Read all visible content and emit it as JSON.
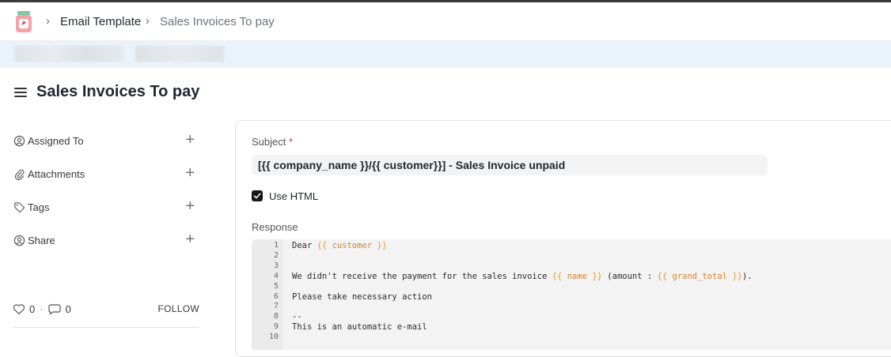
{
  "breadcrumb": {
    "items": [
      "Email Template",
      "Sales Invoices To pay"
    ]
  },
  "page": {
    "title": "Sales Invoices To pay"
  },
  "sidebar": {
    "items": [
      {
        "label": "Assigned To",
        "icon": "assign-user-icon"
      },
      {
        "label": "Attachments",
        "icon": "paperclip-icon"
      },
      {
        "label": "Tags",
        "icon": "tag-icon"
      },
      {
        "label": "Share",
        "icon": "share-user-icon"
      }
    ],
    "likes": "0",
    "comments": "0",
    "follow_label": "FOLLOW"
  },
  "form": {
    "subject_label": "Subject",
    "subject_required_mark": "*",
    "subject_value": "[{{ company_name }}/{{ customer}}] - Sales Invoice unpaid",
    "use_html_label": "Use HTML",
    "use_html_checked": true,
    "response_label": "Response",
    "response_lines": [
      {
        "n": "1",
        "text": "Dear {{ customer }}"
      },
      {
        "n": "2",
        "text": ""
      },
      {
        "n": "3",
        "text": ""
      },
      {
        "n": "4",
        "text": "We didn't receive the payment for the sales invoice {{ name }} (amount : {{ grand_total }})."
      },
      {
        "n": "5",
        "text": ""
      },
      {
        "n": "6",
        "text": "Please take necessary action"
      },
      {
        "n": "7",
        "text": ""
      },
      {
        "n": "8",
        "text": "--"
      },
      {
        "n": "9",
        "text": "This is an automatic e-mail"
      },
      {
        "n": "10",
        "text": ""
      }
    ]
  },
  "colors": {
    "banner_bg": "#eaf2fb",
    "template_var": "#d9822b",
    "checkbox": "#171717",
    "required": "#e03636"
  }
}
